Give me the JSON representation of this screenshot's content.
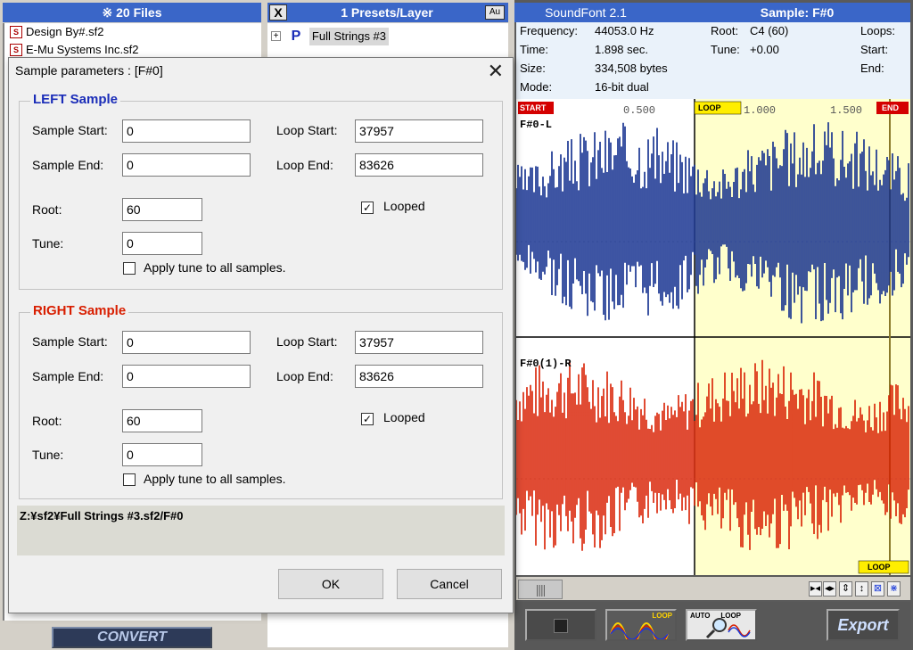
{
  "files": {
    "header": "※ 20 Files",
    "items": [
      {
        "name": "Design By#.sf2"
      },
      {
        "name": "E-Mu Systems Inc.sf2"
      }
    ],
    "convert_label": "CONVERT"
  },
  "presets": {
    "header": "1 Presets/Layer",
    "close_label": "X",
    "au_label": "Au",
    "items": [
      {
        "icon": "P",
        "expander": "+",
        "name": "Full Strings #3"
      }
    ]
  },
  "sample": {
    "app_label": "SoundFont 2.1",
    "title": "Sample: F#0",
    "info": {
      "frequency_label": "Frequency:",
      "frequency_value": "44053.0 Hz",
      "time_label": "Time:",
      "time_value": "1.898 sec.",
      "size_label": "Size:",
      "size_value": "334,508 bytes",
      "mode_label": "Mode:",
      "mode_value": "16-bit dual",
      "root_label": "Root:",
      "root_value": "C4  (60)",
      "tune_label": "Tune:",
      "tune_value": "+0.00",
      "loops_label": "Loops:",
      "start_label": "Start:",
      "end_label": "End:"
    },
    "wave": {
      "start_marker": "START",
      "end_marker": "END",
      "loop_marker": "LOOP",
      "tick_1": "0.500",
      "tick_2": "1.000",
      "tick_3": "1.500",
      "left_channel": "F#0-L",
      "right_channel": "F#0(1)-R",
      "left_color": "#0d2a8c",
      "right_color": "#d81e00",
      "loop_region_color": "#ffffcc"
    },
    "scroll_thumb": "||||",
    "zoom_buttons": [
      "▸◂",
      "◂▸",
      "⇕",
      "↕",
      "⊠",
      "⋇"
    ],
    "tools": {
      "loop_label": "LOOP",
      "auto_label": "AUTO",
      "autoloop_label": "LOOP",
      "export_label": "Export"
    }
  },
  "dialog": {
    "title": "Sample parameters : [F#0]",
    "close": "✕",
    "left": {
      "heading": "LEFT Sample",
      "heading_color": "#1a2cb8",
      "sample_start_label": "Sample Start:",
      "sample_start": "0",
      "sample_end_label": "Sample End:",
      "sample_end": "0",
      "loop_start_label": "Loop Start:",
      "loop_start": "37957",
      "loop_end_label": "Loop End:",
      "loop_end": "83626",
      "root_label": "Root:",
      "root": "60",
      "tune_label": "Tune:",
      "tune": "0",
      "looped_label": "Looped",
      "looped_mark": "✓",
      "apply_label": "Apply tune to all samples."
    },
    "right": {
      "heading": "RIGHT Sample",
      "heading_color": "#d81e00",
      "sample_start_label": "Sample Start:",
      "sample_start": "0",
      "sample_end_label": "Sample End:",
      "sample_end": "0",
      "loop_start_label": "Loop Start:",
      "loop_start": "37957",
      "loop_end_label": "Loop End:",
      "loop_end": "83626",
      "root_label": "Root:",
      "root": "60",
      "tune_label": "Tune:",
      "tune": "0",
      "looped_label": "Looped",
      "looped_mark": "✓",
      "apply_label": "Apply tune to all samples."
    },
    "path": "Z:¥sf2¥Full Strings #3.sf2/F#0",
    "ok_label": "OK",
    "cancel_label": "Cancel"
  }
}
